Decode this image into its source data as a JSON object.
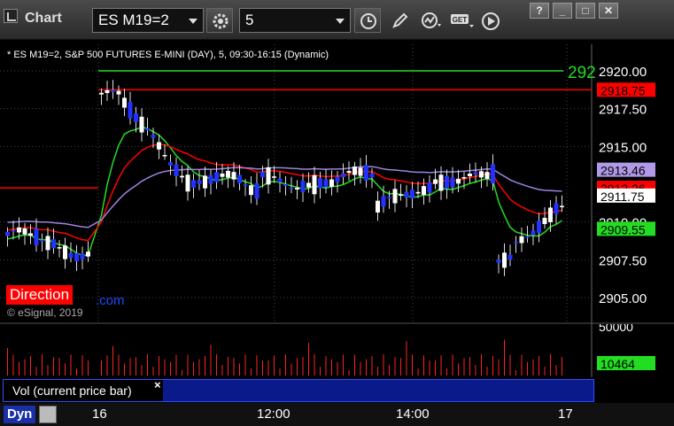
{
  "window": {
    "title": "Chart",
    "symbol": "ES M19=2",
    "interval": "5",
    "buttons": {
      "help": "?",
      "minimize": "_",
      "maximize": "□",
      "close": "✕"
    },
    "tools": [
      "clock-icon",
      "pencil-icon",
      "study-icon",
      "get-icon",
      "play-icon"
    ]
  },
  "chart": {
    "header": "* ES M19=2, S&P 500 FUTURES E-MINI (DAY), 5, 09:30-16:15 (Dynamic)",
    "direction_label": "Direction",
    "direction_suffix": ".com",
    "copyright": "© eSignal, 2019",
    "price_labels": [
      {
        "text": "2920.00",
        "value": 2920.0
      },
      {
        "text": "2917.50",
        "value": 2917.5
      },
      {
        "text": "2915.00",
        "value": 2915.0
      },
      {
        "text": "2910.00",
        "value": 2910.0
      },
      {
        "text": "2907.50",
        "value": 2907.5
      },
      {
        "text": "2905.00",
        "value": 2905.0
      }
    ],
    "price_tags": [
      {
        "text": "2918.75",
        "value": 2918.75,
        "bg": "#ff0000",
        "fg": "#000000"
      },
      {
        "text": "2913.46",
        "value": 2913.46,
        "bg": "#b09ae8",
        "fg": "#000000"
      },
      {
        "text": "2912.26",
        "value": 2912.26,
        "bg": "#ff0000",
        "fg": "#000000"
      },
      {
        "text": "2911.75",
        "value": 2911.75,
        "bg": "#ffffff",
        "fg": "#000000"
      },
      {
        "text": "2909.55",
        "value": 2909.55,
        "bg": "#22dd22",
        "fg": "#000000"
      }
    ],
    "green_level_text": "292",
    "vol_labels": [
      {
        "text": "50000",
        "value": 50000
      },
      {
        "text": "10464",
        "value": 10464
      }
    ],
    "vol_tag_bg": "#22dd22",
    "study_label": "Vol (current price bar)",
    "study_close": "×",
    "dyn_label": "Dyn",
    "x_labels": [
      {
        "text": "16",
        "pos": 0.16
      },
      {
        "text": "12:00",
        "pos": 0.46
      },
      {
        "text": "14:00",
        "pos": 0.7
      },
      {
        "text": "17",
        "pos": 0.96
      }
    ],
    "colors": {
      "up": "#ffffff",
      "down": "#2233ff",
      "vwap": "#9d83e0",
      "red_avg": "#ff0000",
      "green_avg": "#22dd22",
      "volume": "#ff2222"
    }
  }
}
